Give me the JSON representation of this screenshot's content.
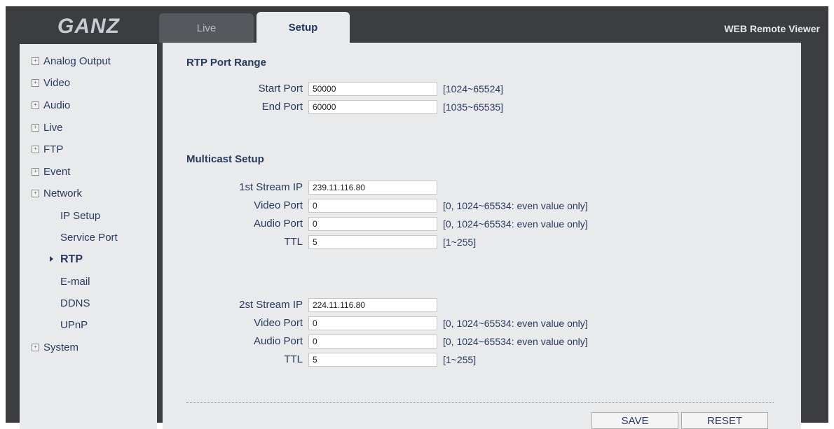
{
  "header": {
    "logo_text": "GANZ",
    "brand": "WEB Remote Viewer",
    "tabs": [
      {
        "label": "Live"
      },
      {
        "label": "Setup"
      }
    ]
  },
  "sidebar": {
    "items": [
      {
        "label": "Analog Output"
      },
      {
        "label": "Video"
      },
      {
        "label": "Audio"
      },
      {
        "label": "Live"
      },
      {
        "label": "FTP"
      },
      {
        "label": "Event"
      },
      {
        "label": "Network"
      },
      {
        "label": "System"
      }
    ],
    "network_sub": [
      {
        "label": "IP Setup"
      },
      {
        "label": "Service Port"
      },
      {
        "label": "RTP"
      },
      {
        "label": "E-mail"
      },
      {
        "label": "DDNS"
      },
      {
        "label": "UPnP"
      }
    ],
    "active_item": "RTP"
  },
  "rtp": {
    "title": "RTP Port Range",
    "start_port": {
      "label": "Start Port",
      "value": "50000",
      "range": "[1024~65524]"
    },
    "end_port": {
      "label": "End Port",
      "value": "60000",
      "range": "[1035~65535]"
    }
  },
  "multicast": {
    "title": "Multicast Setup",
    "stream1": {
      "ip_label": "1st Stream IP",
      "ip_value": "239.11.116.80",
      "video_label": "Video Port",
      "video_value": "0",
      "video_range": "[0, 1024~65534: even value only]",
      "audio_label": "Audio Port",
      "audio_value": "0",
      "audio_range": "[0, 1024~65534: even value only]",
      "ttl_label": "TTL",
      "ttl_value": "5",
      "ttl_range": "[1~255]"
    },
    "stream2": {
      "ip_label": "2st Stream IP",
      "ip_value": "224.11.116.80",
      "video_label": "Video Port",
      "video_value": "0",
      "video_range": "[0, 1024~65534: even value only]",
      "audio_label": "Audio Port",
      "audio_value": "0",
      "audio_range": "[0, 1024~65534: even value only]",
      "ttl_label": "TTL",
      "ttl_value": "5",
      "ttl_range": "[1~255]"
    }
  },
  "buttons": {
    "save": "SAVE",
    "reset": "RESET"
  }
}
